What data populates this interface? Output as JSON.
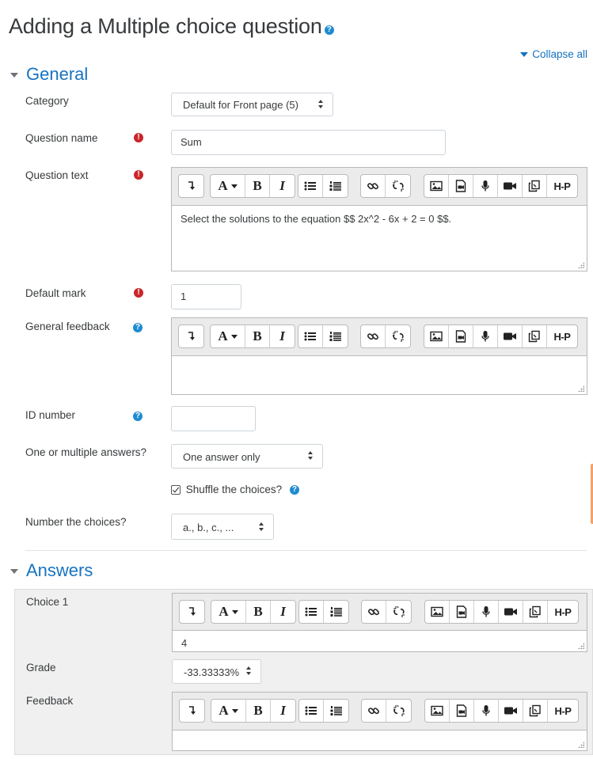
{
  "page": {
    "title": "Adding a Multiple choice question",
    "collapse_all": "Collapse all"
  },
  "sections": {
    "general": "General",
    "answers": "Answers"
  },
  "general": {
    "category": {
      "label": "Category",
      "value": "Default for Front page (5)"
    },
    "question_name": {
      "label": "Question name",
      "value": "Sum"
    },
    "question_text": {
      "label": "Question text",
      "value": "Select the solutions to the equation $$ 2x^2 - 6x + 2 = 0 $$."
    },
    "default_mark": {
      "label": "Default mark",
      "value": "1"
    },
    "general_feedback": {
      "label": "General feedback",
      "value": ""
    },
    "id_number": {
      "label": "ID number",
      "value": ""
    },
    "one_or_multiple": {
      "label": "One or multiple answers?",
      "value": "One answer only"
    },
    "shuffle": {
      "label": "Shuffle the choices?",
      "checked": true
    },
    "number_choices": {
      "label": "Number the choices?",
      "value": "a., b., c., ..."
    }
  },
  "answers": {
    "choice1": {
      "label": "Choice 1",
      "value": "4"
    },
    "grade": {
      "label": "Grade",
      "value": "-33.33333%"
    },
    "feedback": {
      "label": "Feedback",
      "value": ""
    }
  },
  "toolbar_icons": [
    "show-more-buttons-icon",
    "font-color-icon",
    "bold-icon",
    "italic-icon",
    "unordered-list-icon",
    "ordered-list-icon",
    "link-icon",
    "unlink-icon",
    "image-icon",
    "media-icon",
    "record-audio-icon",
    "record-video-icon",
    "manage-files-icon",
    "h5p-icon"
  ],
  "toolbar_text": {
    "bold": "B",
    "italic": "I",
    "font": "A",
    "h5p": "H-P"
  },
  "colors": {
    "link": "#1773c0",
    "required": "#c9262b",
    "help": "#1f8bd0",
    "panel": "#f0f0f0"
  }
}
